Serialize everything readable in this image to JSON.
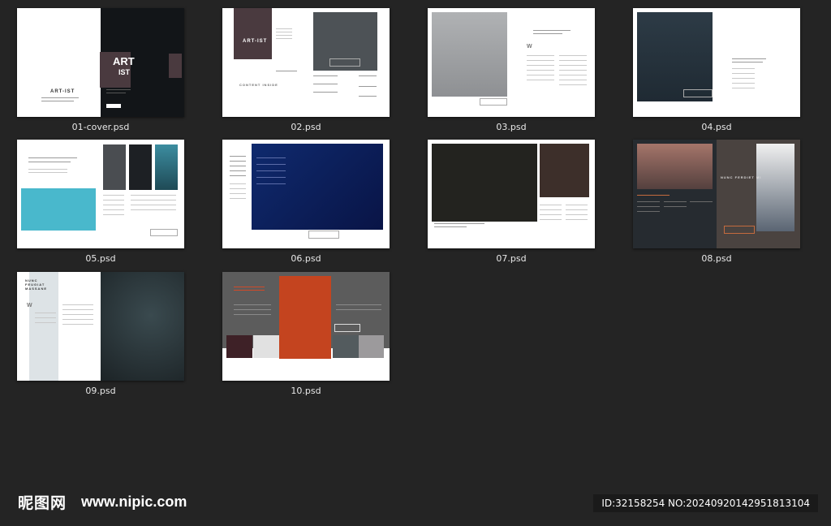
{
  "files": [
    {
      "name": "01-cover.psd"
    },
    {
      "name": "02.psd"
    },
    {
      "name": "03.psd"
    },
    {
      "name": "04.psd"
    },
    {
      "name": "05.psd"
    },
    {
      "name": "06.psd"
    },
    {
      "name": "07.psd"
    },
    {
      "name": "08.psd"
    },
    {
      "name": "09.psd"
    },
    {
      "name": "10.psd"
    }
  ],
  "thumbnail_text": {
    "cover_logo_top": "ART",
    "cover_logo_bottom": "IST",
    "cover_title": "ART-IST",
    "page2_logo": "ART-IST",
    "page2_contents": "CONTENT INSIDE",
    "page8_heading": "NUNC FERDIET MI",
    "page9_heading": "NUNC FEUGIAT MASSANE",
    "page9_dropcap": "W",
    "page3_dropcap": "W"
  },
  "watermark": {
    "logo": "昵图网",
    "url": "www.nipic.com",
    "id_text": "ID:32158254 NO:20240920142951813104"
  },
  "colors": {
    "background": "#242424",
    "page": "#ffffff",
    "cover_dark": "#121518",
    "logo_plum": "#4a3a3f",
    "teal": "#49b8cc",
    "navy": "#0d1d5c",
    "rust": "#c4441f"
  }
}
